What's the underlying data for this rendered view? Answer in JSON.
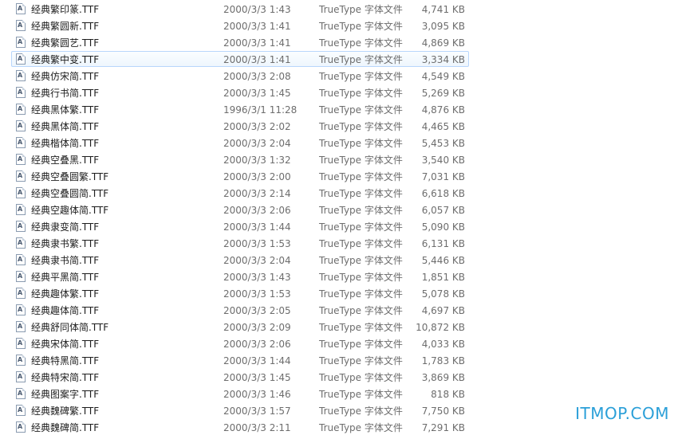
{
  "files": [
    {
      "name": "经典繁印篆.TTF",
      "date": "2000/3/3 1:43",
      "type": "TrueType 字体文件",
      "size": "4,741 KB"
    },
    {
      "name": "经典繁圆新.TTF",
      "date": "2000/3/3 1:41",
      "type": "TrueType 字体文件",
      "size": "3,095 KB"
    },
    {
      "name": "经典繁圆艺.TTF",
      "date": "2000/3/3 1:41",
      "type": "TrueType 字体文件",
      "size": "4,869 KB"
    },
    {
      "name": "经典繁中变.TTF",
      "date": "2000/3/3 1:41",
      "type": "TrueType 字体文件",
      "size": "3,334 KB",
      "hover": true
    },
    {
      "name": "经典仿宋简.TTF",
      "date": "2000/3/3 2:08",
      "type": "TrueType 字体文件",
      "size": "4,549 KB"
    },
    {
      "name": "经典行书简.TTF",
      "date": "2000/3/3 1:45",
      "type": "TrueType 字体文件",
      "size": "5,269 KB"
    },
    {
      "name": "经典黑体繁.TTF",
      "date": "1996/3/1 11:28",
      "type": "TrueType 字体文件",
      "size": "4,876 KB"
    },
    {
      "name": "经典黑体简.TTF",
      "date": "2000/3/3 2:02",
      "type": "TrueType 字体文件",
      "size": "4,465 KB"
    },
    {
      "name": "经典楷体简.TTF",
      "date": "2000/3/3 2:04",
      "type": "TrueType 字体文件",
      "size": "5,453 KB"
    },
    {
      "name": "经典空叠黑.TTF",
      "date": "2000/3/3 1:32",
      "type": "TrueType 字体文件",
      "size": "3,540 KB"
    },
    {
      "name": "经典空叠圆繁.TTF",
      "date": "2000/3/3 2:00",
      "type": "TrueType 字体文件",
      "size": "7,031 KB"
    },
    {
      "name": "经典空叠圆简.TTF",
      "date": "2000/3/3 2:14",
      "type": "TrueType 字体文件",
      "size": "6,618 KB"
    },
    {
      "name": "经典空趣体简.TTF",
      "date": "2000/3/3 2:06",
      "type": "TrueType 字体文件",
      "size": "6,057 KB"
    },
    {
      "name": "经典隶变简.TTF",
      "date": "2000/3/3 1:44",
      "type": "TrueType 字体文件",
      "size": "5,090 KB"
    },
    {
      "name": "经典隶书繁.TTF",
      "date": "2000/3/3 1:53",
      "type": "TrueType 字体文件",
      "size": "6,131 KB"
    },
    {
      "name": "经典隶书简.TTF",
      "date": "2000/3/3 2:04",
      "type": "TrueType 字体文件",
      "size": "5,446 KB"
    },
    {
      "name": "经典平黑简.TTF",
      "date": "2000/3/3 1:43",
      "type": "TrueType 字体文件",
      "size": "1,851 KB"
    },
    {
      "name": "经典趣体繁.TTF",
      "date": "2000/3/3 1:53",
      "type": "TrueType 字体文件",
      "size": "5,078 KB"
    },
    {
      "name": "经典趣体简.TTF",
      "date": "2000/3/3 2:05",
      "type": "TrueType 字体文件",
      "size": "4,697 KB"
    },
    {
      "name": "经典舒同体简.TTF",
      "date": "2000/3/3 2:09",
      "type": "TrueType 字体文件",
      "size": "10,872 KB"
    },
    {
      "name": "经典宋体简.TTF",
      "date": "2000/3/3 2:06",
      "type": "TrueType 字体文件",
      "size": "4,033 KB"
    },
    {
      "name": "经典特黑简.TTF",
      "date": "2000/3/3 1:44",
      "type": "TrueType 字体文件",
      "size": "1,783 KB"
    },
    {
      "name": "经典特宋简.TTF",
      "date": "2000/3/3 1:45",
      "type": "TrueType 字体文件",
      "size": "3,869 KB"
    },
    {
      "name": "经典图案字.TTF",
      "date": "2000/3/3 1:46",
      "type": "TrueType 字体文件",
      "size": "818 KB"
    },
    {
      "name": "经典魏碑繁.TTF",
      "date": "2000/3/3 1:57",
      "type": "TrueType 字体文件",
      "size": "7,750 KB"
    },
    {
      "name": "经典魏碑简.TTF",
      "date": "2000/3/3 2:11",
      "type": "TrueType 字体文件",
      "size": "7,291 KB"
    }
  ],
  "watermark": "ITMOP.COM",
  "colors": {
    "hover_border": "#b8d6fb",
    "watermark": "#2a9fd8",
    "detail_text": "#6d6d6d"
  }
}
